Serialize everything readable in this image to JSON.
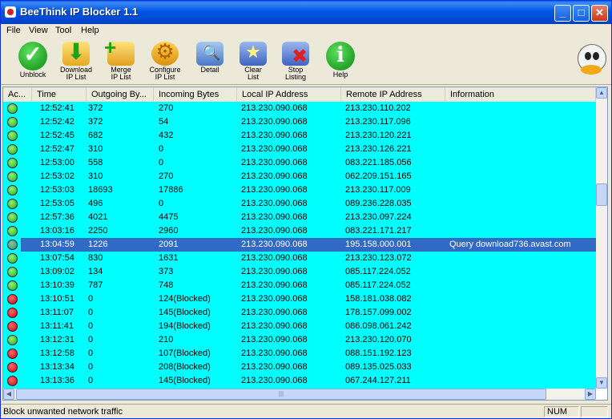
{
  "window": {
    "title": "BeeThink IP Blocker 1.1",
    "controls": {
      "minimize": "_",
      "maximize": "□",
      "close": "✕"
    }
  },
  "menu": [
    "File",
    "View",
    "Tool",
    "Help"
  ],
  "toolbar": [
    {
      "label": "Unblock",
      "icon": "unblock-check-icon"
    },
    {
      "label": "Download\nIP List",
      "icon": "download-icon"
    },
    {
      "label": "Merge\nIP List",
      "icon": "merge-icon"
    },
    {
      "label": "Configure\nIP List",
      "icon": "configure-icon"
    },
    {
      "label": "Detail",
      "icon": "detail-icon"
    },
    {
      "label": "Clear\nList",
      "icon": "clear-icon"
    },
    {
      "label": "Stop\nListing",
      "icon": "stop-icon"
    },
    {
      "label": "Help",
      "icon": "help-icon"
    }
  ],
  "list": {
    "columns": [
      "Ac...",
      "Time",
      "Outgoing By...",
      "Incoming Bytes",
      "Local IP Address",
      "Remote IP Address",
      "Information"
    ],
    "rows": [
      {
        "status": "ok",
        "time": "12:52:41",
        "out": "372",
        "in": "270",
        "local": "213.230.090.068",
        "remote": "213.230.110.202",
        "info": ""
      },
      {
        "status": "ok",
        "time": "12:52:42",
        "out": "372",
        "in": "54",
        "local": "213.230.090.068",
        "remote": "213.230.117.096",
        "info": ""
      },
      {
        "status": "ok",
        "time": "12:52:45",
        "out": "682",
        "in": "432",
        "local": "213.230.090.068",
        "remote": "213.230.120.221",
        "info": ""
      },
      {
        "status": "ok",
        "time": "12:52:47",
        "out": "310",
        "in": "0",
        "local": "213.230.090.068",
        "remote": "213.230.126.221",
        "info": ""
      },
      {
        "status": "ok",
        "time": "12:53:00",
        "out": "558",
        "in": "0",
        "local": "213.230.090.068",
        "remote": "083.221.185.056",
        "info": ""
      },
      {
        "status": "ok",
        "time": "12:53:02",
        "out": "310",
        "in": "270",
        "local": "213.230.090.068",
        "remote": "062.209.151.165",
        "info": ""
      },
      {
        "status": "ok",
        "time": "12:53:03",
        "out": "18693",
        "in": "17886",
        "local": "213.230.090.068",
        "remote": "213.230.117.009",
        "info": ""
      },
      {
        "status": "ok",
        "time": "12:53:05",
        "out": "496",
        "in": "0",
        "local": "213.230.090.068",
        "remote": "089.236.228.035",
        "info": ""
      },
      {
        "status": "ok",
        "time": "12:57:36",
        "out": "4021",
        "in": "4475",
        "local": "213.230.090.068",
        "remote": "213.230.097.224",
        "info": ""
      },
      {
        "status": "ok",
        "time": "13:03:16",
        "out": "2250",
        "in": "2960",
        "local": "213.230.090.068",
        "remote": "083.221.171.217",
        "info": ""
      },
      {
        "status": "sel",
        "time": "13:04:59",
        "out": "1226",
        "in": "2091",
        "local": "213.230.090.068",
        "remote": "195.158.000.001",
        "info": "Query download736.avast.com",
        "selected": true
      },
      {
        "status": "ok",
        "time": "13:07:54",
        "out": "830",
        "in": "1631",
        "local": "213.230.090.068",
        "remote": "213.230.123.072",
        "info": ""
      },
      {
        "status": "ok",
        "time": "13:09:02",
        "out": "134",
        "in": "373",
        "local": "213.230.090.068",
        "remote": "085.117.224.052",
        "info": ""
      },
      {
        "status": "ok",
        "time": "13:10:39",
        "out": "787",
        "in": "748",
        "local": "213.230.090.068",
        "remote": "085.117.224.052",
        "info": ""
      },
      {
        "status": "blocked",
        "time": "13:10:51",
        "out": "0",
        "in": "124(Blocked)",
        "local": "213.230.090.068",
        "remote": "158.181.038.082",
        "info": ""
      },
      {
        "status": "blocked",
        "time": "13:11:07",
        "out": "0",
        "in": "145(Blocked)",
        "local": "213.230.090.068",
        "remote": "178.157.099.002",
        "info": ""
      },
      {
        "status": "blocked",
        "time": "13:11:41",
        "out": "0",
        "in": "194(Blocked)",
        "local": "213.230.090.068",
        "remote": "086.098.061.242",
        "info": ""
      },
      {
        "status": "ok",
        "time": "13:12:31",
        "out": "0",
        "in": "210",
        "local": "213.230.090.068",
        "remote": "213.230.120.070",
        "info": ""
      },
      {
        "status": "blocked",
        "time": "13:12:58",
        "out": "0",
        "in": "107(Blocked)",
        "local": "213.230.090.068",
        "remote": "088.151.192.123",
        "info": ""
      },
      {
        "status": "blocked",
        "time": "13:13:34",
        "out": "0",
        "in": "208(Blocked)",
        "local": "213.230.090.068",
        "remote": "089.135.025.033",
        "info": ""
      },
      {
        "status": "blocked",
        "time": "13:13:36",
        "out": "0",
        "in": "145(Blocked)",
        "local": "213.230.090.068",
        "remote": "067.244.127.211",
        "info": ""
      }
    ]
  },
  "status": {
    "text": "Block unwanted network traffic",
    "num": "NUM"
  },
  "colors": {
    "row_bg": "#00ffff",
    "selected": "#316ac5",
    "title": "#0055e5"
  }
}
